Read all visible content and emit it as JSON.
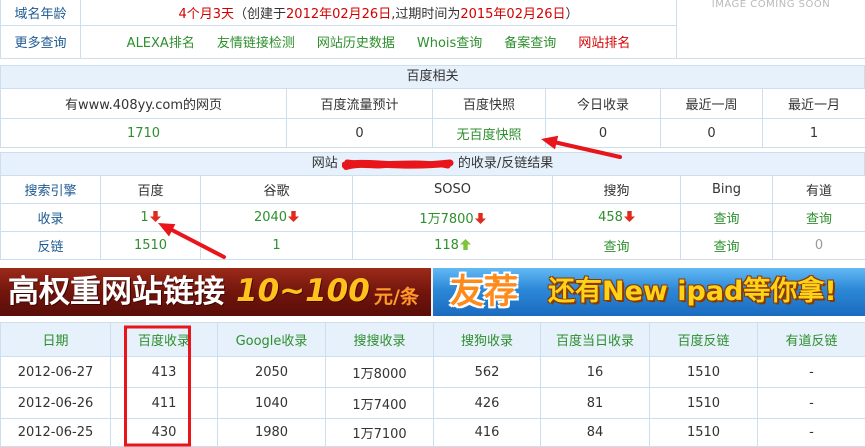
{
  "domain_info": {
    "age_label": "域名年龄",
    "age": "4个月3天",
    "created_prefix": "（创建于",
    "created_date": "2012年02月26日",
    "expire_prefix": ",过期时间为",
    "expire_date": "2015年02月26日",
    "suffix": "）",
    "thumbnail_text": "IMAGE COMING SOON",
    "more_label": "更多查询",
    "links": [
      "ALEXA排名",
      "友情链接检测",
      "网站历史数据",
      "Whois查询",
      "备案查询",
      "网站排名"
    ]
  },
  "baidu": {
    "title": "百度相关",
    "headers": [
      "有www.408yy.com的网页",
      "百度流量预计",
      "百度快照",
      "今日收录",
      "最近一周",
      "最近一月"
    ],
    "values": [
      "1710",
      "0",
      "无百度快照",
      "0",
      "0",
      "1"
    ]
  },
  "engines": {
    "title_prefix": "网站",
    "title_suffix": "的收录/反链结果",
    "headers": [
      "搜索引擎",
      "百度",
      "谷歌",
      "SOSO",
      "搜狗",
      "Bing",
      "有道"
    ],
    "indexed": {
      "label": "收录",
      "cells": [
        {
          "value": "1",
          "icon": "down-arrow-icon"
        },
        {
          "value": "2040",
          "icon": "down-arrow-icon"
        },
        {
          "value": "1万7800",
          "icon": "down-arrow-icon"
        },
        {
          "value": "458",
          "icon": "down-arrow-icon"
        },
        {
          "value": "查询"
        },
        {
          "value": "查询"
        }
      ]
    },
    "backlinks": {
      "label": "反链",
      "cells": [
        {
          "value": "1510"
        },
        {
          "value": "1"
        },
        {
          "value": "118",
          "icon": "up-arrow-icon"
        },
        {
          "value": "查询"
        },
        {
          "value": "查询"
        },
        {
          "value": "0"
        }
      ]
    }
  },
  "banner": {
    "headline": "高权重网站链接",
    "price": "10~100",
    "unit": "元/条",
    "brand": "友荐",
    "promo": "还有New ipad等你拿!"
  },
  "history": {
    "headers": [
      "日期",
      "百度收录",
      "Google收录",
      "搜搜收录",
      "搜狗收录",
      "百度当日收录",
      "百度反链",
      "有道反链"
    ],
    "rows": [
      [
        "2012-06-27",
        "413",
        "2050",
        "1万8000",
        "562",
        "16",
        "1510",
        "-"
      ],
      [
        "2012-06-26",
        "411",
        "1040",
        "1万7400",
        "426",
        "81",
        "1510",
        "-"
      ],
      [
        "2012-06-25",
        "430",
        "1980",
        "1万7100",
        "416",
        "84",
        "1510",
        "-"
      ]
    ]
  },
  "colors": {
    "link_green": "#2e8f2e",
    "highlight_red": "#d40000",
    "label_blue": "#1d5a91",
    "header_bg": "#e6f1fb",
    "border": "#cddeec",
    "annotation_red": "#e8161b"
  }
}
